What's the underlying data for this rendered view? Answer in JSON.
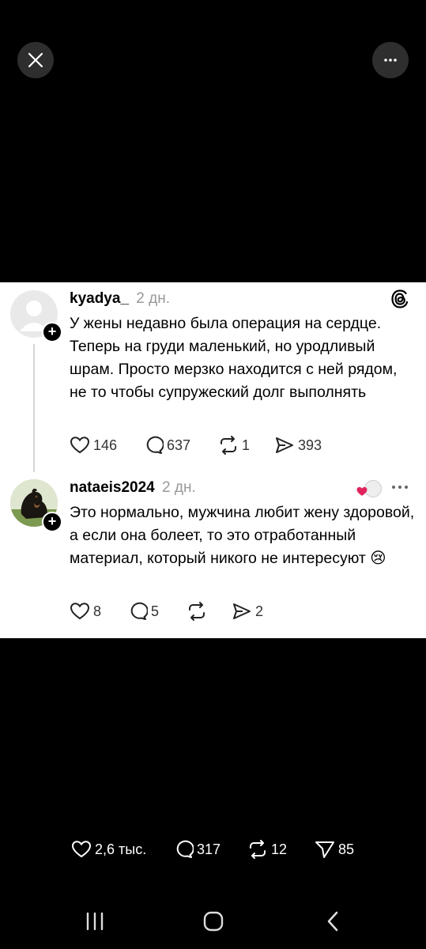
{
  "top": {
    "close_icon": "close-icon",
    "more_icon": "more-icon"
  },
  "posts": [
    {
      "username": "kyadya_",
      "time": "2 дн.",
      "text": "У жены недавно была операция на сердце. Теперь на груди маленький, но уродливый шрам. Просто мерзко находится с ней рядом, не то чтобы супружеский долг выполнять",
      "likes": "146",
      "replies": "637",
      "reposts": "1",
      "shares": "393"
    },
    {
      "username": "nataeis2024",
      "time": "2 дн.",
      "text": "Это нормально, мужчина любит жену здоровой, а если она болеет, то это отработанный материал, который никого не интересуют",
      "emoji": "😢",
      "likes": "8",
      "replies": "5",
      "reposts": "",
      "shares": "2"
    }
  ],
  "bottom": {
    "likes": "2,6 тыс.",
    "replies": "317",
    "reposts": "12",
    "shares": "85"
  },
  "colors": {
    "background": "#000000",
    "card": "#ffffff",
    "like_red": "#e0245e"
  }
}
